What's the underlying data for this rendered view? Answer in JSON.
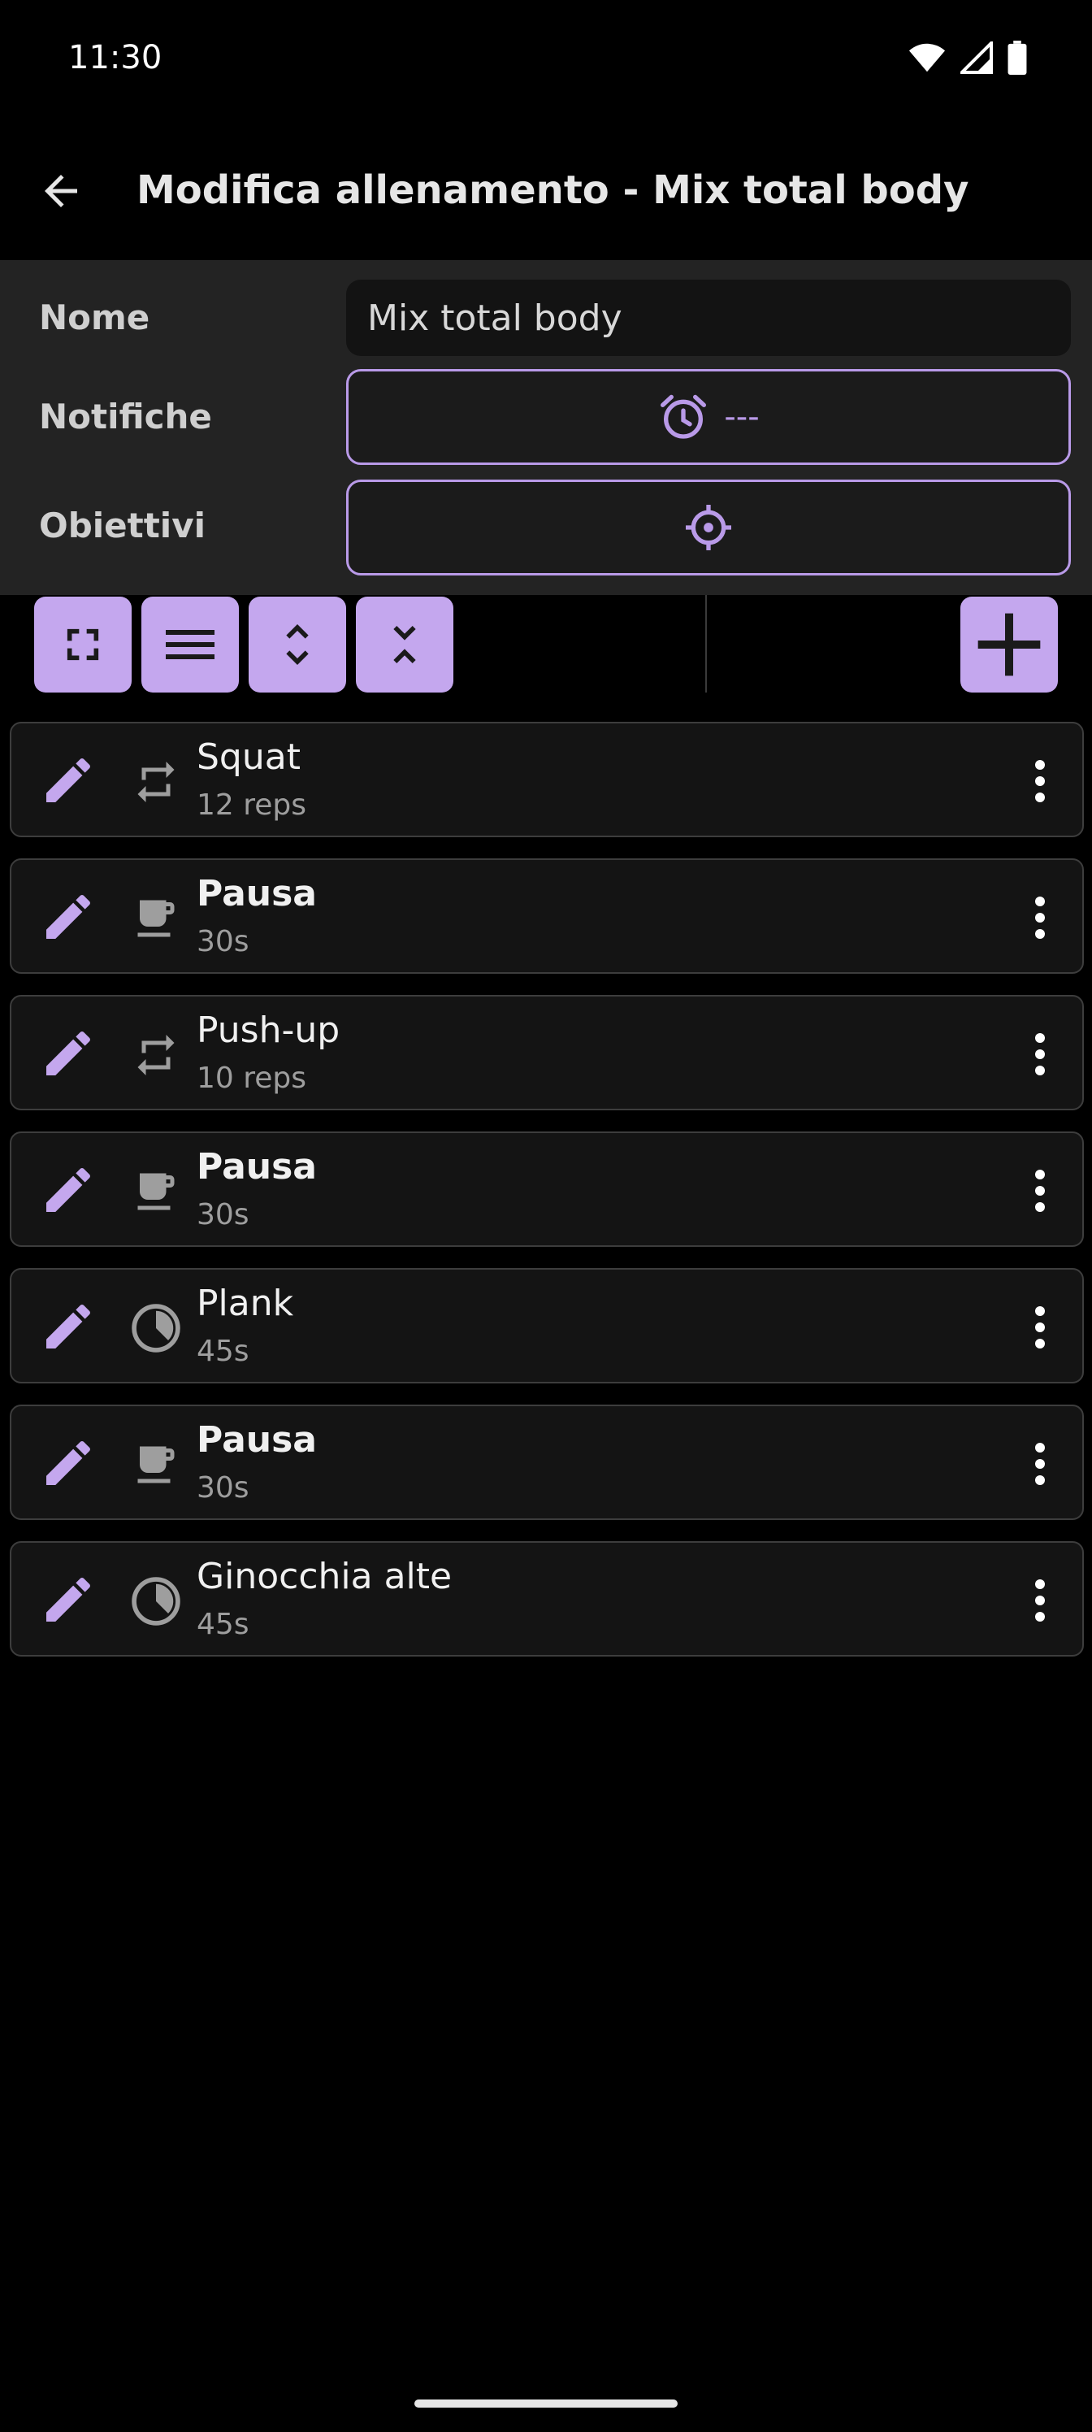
{
  "status_bar": {
    "time": "11:30"
  },
  "app_bar": {
    "title": "Modifica allenamento - Mix total body"
  },
  "form": {
    "name_label": "Nome",
    "name_value": "Mix total body",
    "notifications_label": "Notifiche",
    "notifications_value": "---",
    "goals_label": "Obiettivi"
  },
  "colors": {
    "accent": "#c4a7ee",
    "outline": "#b99ae8",
    "background": "#000000",
    "panel": "#232323"
  },
  "exercises": [
    {
      "name": "Squat",
      "detail": "12 reps",
      "type": "repeat-icon",
      "bold": false
    },
    {
      "name": "Pausa",
      "detail": "30s",
      "type": "coffee-cup-icon",
      "bold": true
    },
    {
      "name": "Push-up",
      "detail": "10 reps",
      "type": "repeat-icon",
      "bold": false
    },
    {
      "name": "Pausa",
      "detail": "30s",
      "type": "coffee-cup-icon",
      "bold": true
    },
    {
      "name": "Plank",
      "detail": "45s",
      "type": "timer-pie-icon",
      "bold": false
    },
    {
      "name": "Pausa",
      "detail": "30s",
      "type": "coffee-cup-icon",
      "bold": true
    },
    {
      "name": "Ginocchia alte",
      "detail": "45s",
      "type": "timer-pie-icon",
      "bold": false
    }
  ]
}
